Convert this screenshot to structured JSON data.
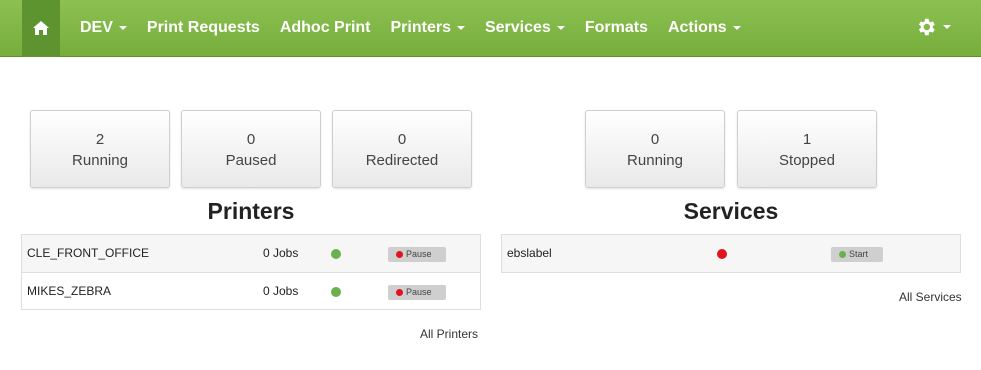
{
  "colors": {
    "nav_bg": "#7db443",
    "running": "#6ab04c",
    "stopped": "#e0141e"
  },
  "nav": {
    "items": [
      {
        "label": "DEV",
        "dropdown": true
      },
      {
        "label": "Print Requests",
        "dropdown": false
      },
      {
        "label": "Adhoc Print",
        "dropdown": false
      },
      {
        "label": "Printers",
        "dropdown": true
      },
      {
        "label": "Services",
        "dropdown": true
      },
      {
        "label": "Formats",
        "dropdown": false
      },
      {
        "label": "Actions",
        "dropdown": true
      }
    ],
    "home_icon": "home-icon",
    "settings_icon": "gear-icon"
  },
  "printer_stats": [
    {
      "count": "2",
      "label": "Running"
    },
    {
      "count": "0",
      "label": "Paused"
    },
    {
      "count": "0",
      "label": "Redirected"
    }
  ],
  "service_stats": [
    {
      "count": "0",
      "label": "Running"
    },
    {
      "count": "1",
      "label": "Stopped"
    }
  ],
  "printers": {
    "title": "Printers",
    "rows": [
      {
        "name": "CLE_FRONT_OFFICE",
        "jobs": "0 Jobs",
        "status": "running",
        "action": "Pause"
      },
      {
        "name": "MIKES_ZEBRA",
        "jobs": "0 Jobs",
        "status": "running",
        "action": "Pause"
      }
    ],
    "link": "All Printers"
  },
  "services": {
    "title": "Services",
    "rows": [
      {
        "name": "ebslabel",
        "status": "stopped",
        "action": "Start"
      }
    ],
    "link": "All Services"
  }
}
